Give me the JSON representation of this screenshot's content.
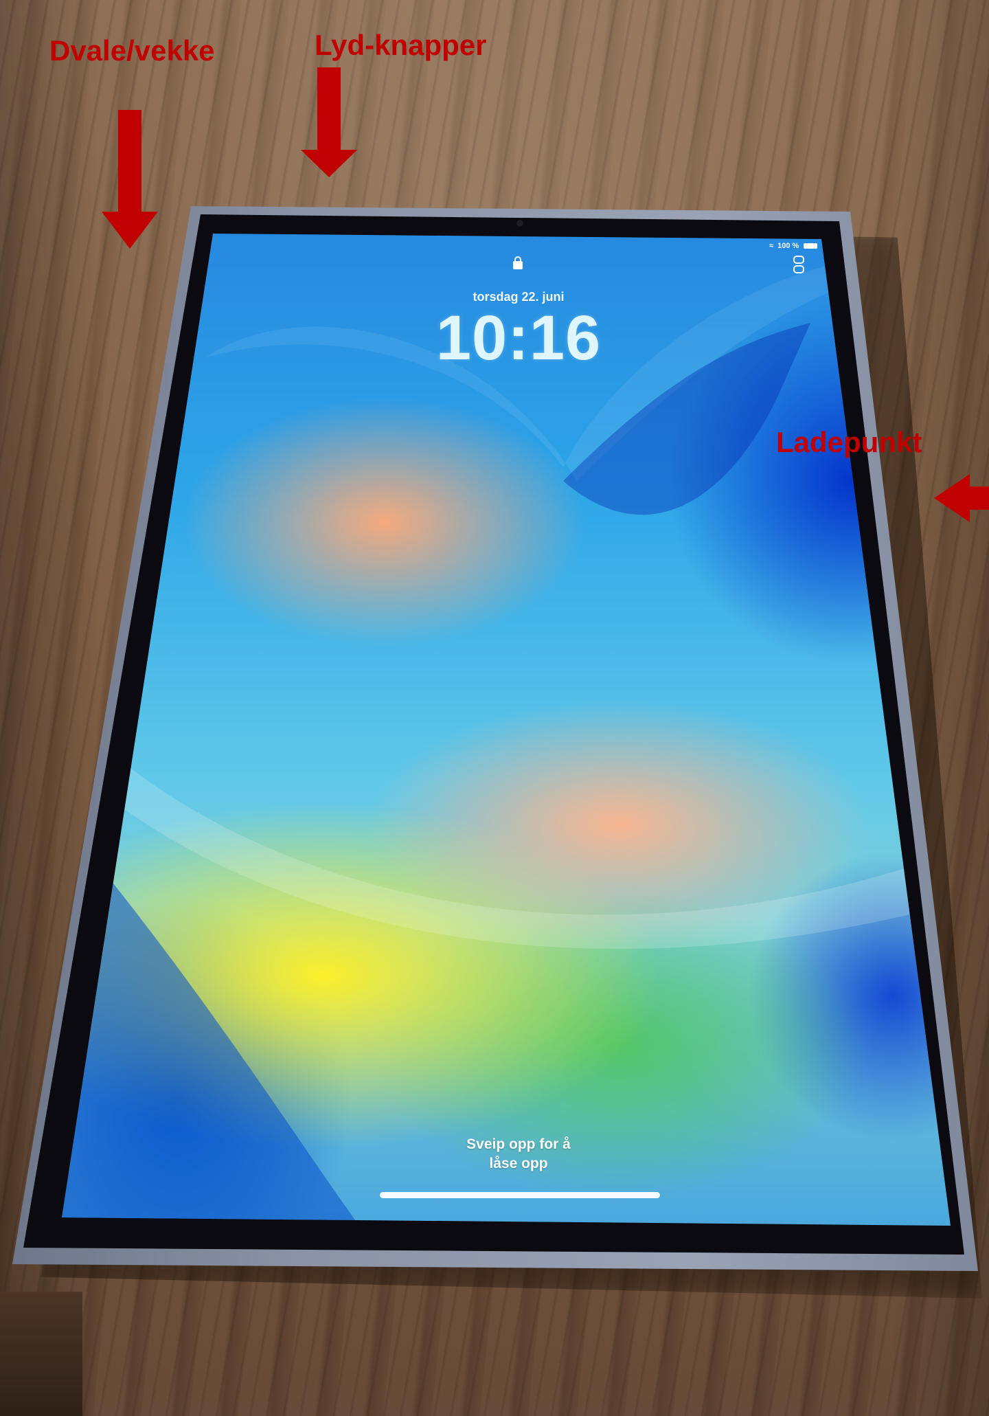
{
  "annotations": {
    "sleep_wake": "Dvale/vekke",
    "volume_buttons": "Lyd-knapper",
    "charging_port": "Ladepunkt",
    "arrow_color": "#c00000"
  },
  "lock_screen": {
    "date": "torsdag 22. juni",
    "time": "10:16",
    "unlock_hint_line1": "Sveip opp for å",
    "unlock_hint_line2": "låse opp",
    "battery": "100 %"
  }
}
